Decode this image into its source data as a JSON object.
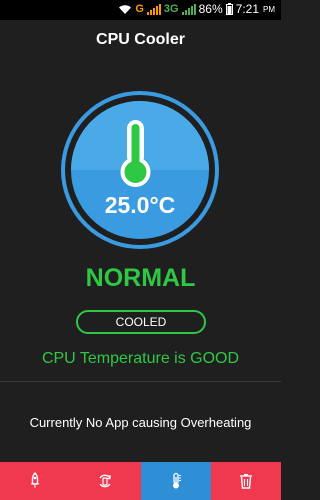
{
  "status_bar": {
    "network_g": "G",
    "network_3g": "3G",
    "battery": "86%",
    "time": "7:21",
    "ampm": "PM"
  },
  "app": {
    "title": "CPU Cooler"
  },
  "gauge": {
    "temperature": "25.0°C",
    "icon": "thermometer-icon",
    "color": "#3a9be0"
  },
  "status": {
    "state": "NORMAL",
    "badge": "COOLED",
    "message": "CPU Temperature is GOOD",
    "overheat_message": "Currently No App causing Overheating",
    "accent": "#2ec845"
  },
  "bottom_nav": {
    "tabs": [
      {
        "icon": "rocket-icon",
        "active": false
      },
      {
        "icon": "cleaner-icon",
        "active": false
      },
      {
        "icon": "thermometer-icon",
        "active": true
      },
      {
        "icon": "trash-icon",
        "active": false
      }
    ],
    "color": "#f0384f",
    "active_color": "#2e8fd6"
  }
}
